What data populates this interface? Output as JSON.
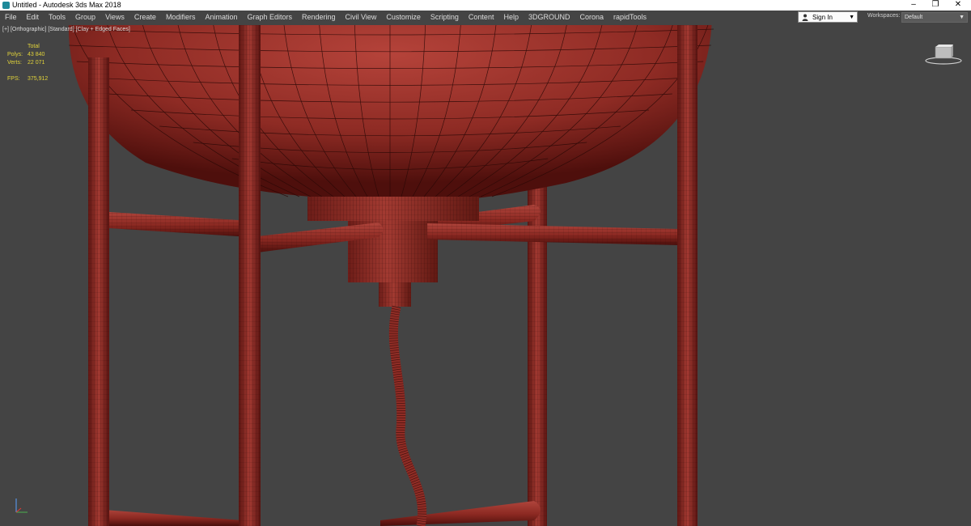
{
  "window": {
    "title": "Untitled - Autodesk 3ds Max 2018",
    "controls": {
      "minimize": "–",
      "restore": "❐",
      "close": "✕"
    }
  },
  "menu": {
    "items": [
      "File",
      "Edit",
      "Tools",
      "Group",
      "Views",
      "Create",
      "Modifiers",
      "Animation",
      "Graph Editors",
      "Rendering",
      "Civil View",
      "Customize",
      "Scripting",
      "Content",
      "Help",
      "3DGROUND",
      "Corona",
      "rapidTools"
    ]
  },
  "account": {
    "sign_in": "Sign In",
    "dropdown_arrow": "▼"
  },
  "workspaces": {
    "label": "Workspaces:",
    "value": "Default",
    "dropdown_arrow": "▼"
  },
  "viewport": {
    "labels": [
      "[+]",
      "[Orthographic]",
      "[Standard]",
      "[Clay + Edged Faces]"
    ],
    "stats": {
      "total_label": "Total",
      "polys_label": "Polys:",
      "polys_value": "43 840",
      "verts_label": "Verts:",
      "verts_value": "22 071",
      "fps_label": "FPS:",
      "fps_value": "375,912"
    },
    "colors": {
      "background": "#444444",
      "model": "#8b2a24",
      "wire": "#2a0806",
      "stats_text": "#e0d23a"
    }
  }
}
